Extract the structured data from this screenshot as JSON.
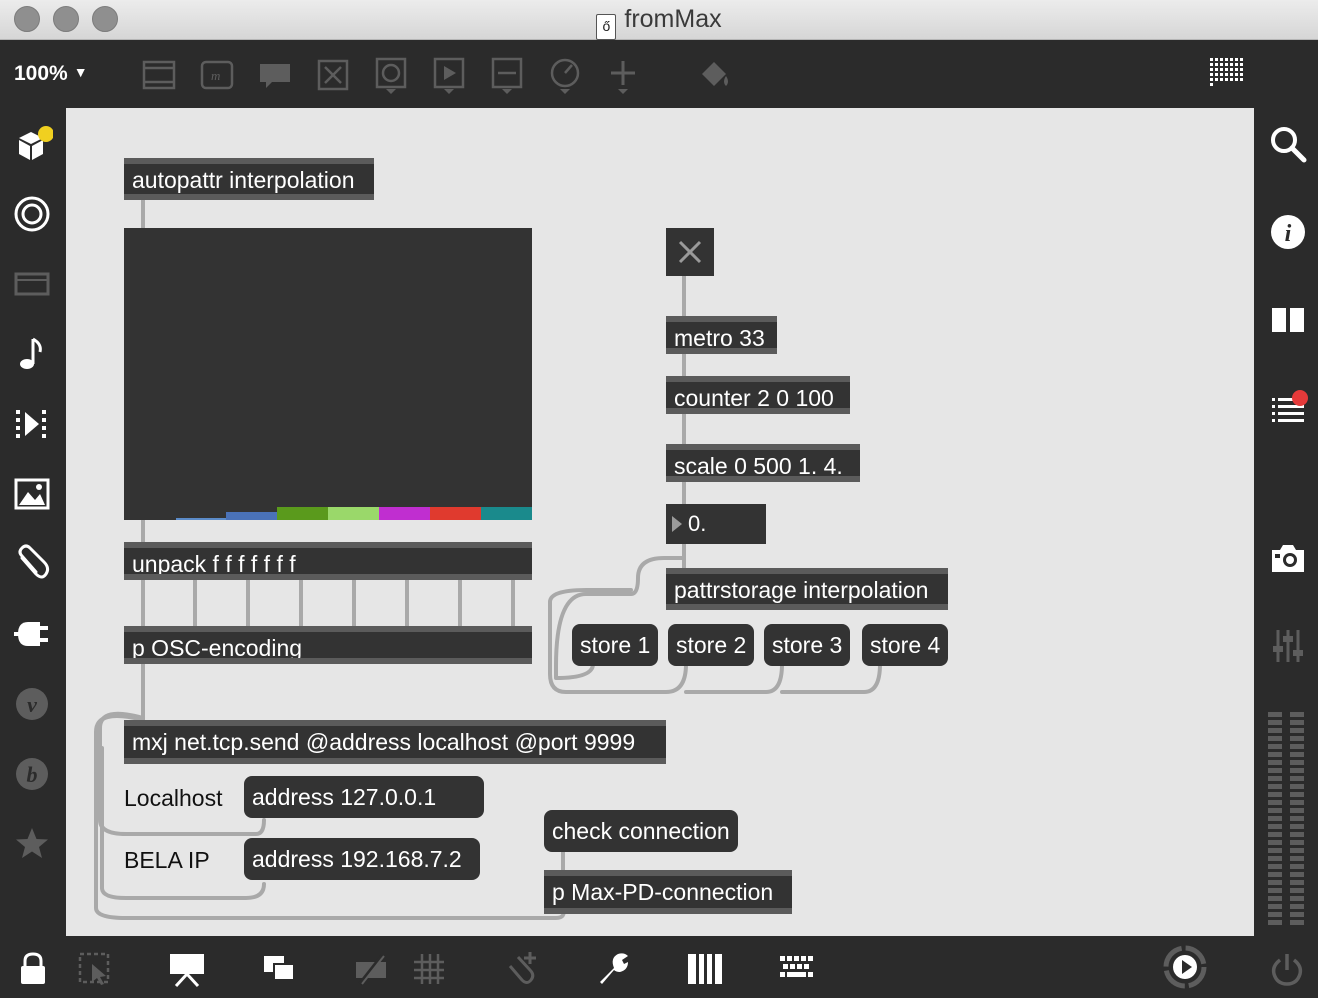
{
  "window": {
    "title": "fromMax"
  },
  "toolbar": {
    "zoom": "100%"
  },
  "objects": {
    "autopattr": "autopattr interpolation",
    "metro": "metro 33",
    "counter": "counter 2 0 100",
    "scale": "scale 0 500 1. 4.",
    "number_value": "0.",
    "pattrstorage": "pattrstorage interpolation",
    "unpack": "unpack f f f f f f f",
    "osc": "p OSC-encoding",
    "mxj": "mxj net.tcp.send @address localhost @port 9999",
    "maxpd": "p Max-PD-connection"
  },
  "messages": {
    "store1": "store 1",
    "store2": "store 2",
    "store3": "store 3",
    "store4": "store 4",
    "address_local": "address 127.0.0.1",
    "address_bela": "address 192.168.7.2",
    "check": "check connection"
  },
  "comments": {
    "localhost": "Localhost",
    "bela": "BELA IP"
  },
  "multislider": {
    "slider_colors": [
      "#5b8bc8",
      "#4a72b8",
      "#5a9a1c",
      "#9ad86a",
      "#c02ed0",
      "#e03a2e",
      "#1a8a8c"
    ]
  }
}
